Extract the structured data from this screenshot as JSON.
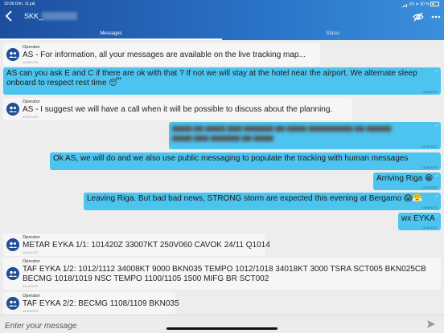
{
  "status_bar": {
    "time": "10:56",
    "date": "Dim. 11 juil.",
    "network": "3G",
    "battery": "50 %"
  },
  "header": {
    "title": "SKK_",
    "tabs": [
      {
        "label": "Messages",
        "active": true
      },
      {
        "label": "Status",
        "active": false
      }
    ]
  },
  "messages": [
    {
      "type": "operator",
      "sender": "Operator",
      "text": "AS - For information, all your messages are available on the live tracking map...",
      "time": "12:26 UTC"
    },
    {
      "type": "outgoing",
      "text": "AS can you ask E and C if there are ok with that ? If not we will stay at the hotel near the airport. We alternate sleep onboard to respect rest time 😴",
      "time": "12:28 UTC"
    },
    {
      "type": "operator",
      "sender": "Operator",
      "text": "AS - I suggest we will have a call when it will be possible to discuss about the planning.",
      "time": "12:37 UTC"
    },
    {
      "type": "outgoing",
      "blurred": true,
      "text": "",
      "time": "12:57 UTC"
    },
    {
      "type": "outgoing",
      "text": "Ok AS, we will do and we also use public messaging to populate the tracking with human messages",
      "time": "13:35 UTC"
    },
    {
      "type": "outgoing",
      "text": "Arriving Riga 😁",
      "time": "13:53 UTC"
    },
    {
      "type": "outgoing",
      "text": "Leaving Riga. But bad bad news, STRONG storm are expected this evening at Bergamo 😱😤",
      "time": "14:38 UTC"
    },
    {
      "type": "outgoing",
      "text": "wx EYKA",
      "time": "14:44 UTC"
    },
    {
      "type": "operator",
      "sender": "Operator",
      "text": "METAR EYKA 1/1: 101420Z 33007KT 250V060 CAVOK 24/11 Q1014",
      "time": "14:44 UTC"
    },
    {
      "type": "operator",
      "sender": "Operator",
      "text": "TAF EYKA 1/2: 1012/1112 34008KT 9000 BKN035  TEMPO 1012/1018 34018KT 3000 TSRA SCT005 BKN025CB BECMG 1018/1019 NSC  TEMPO 1100/1105 1500 MIFG BR SCT002",
      "time": "14:44 UTC"
    },
    {
      "type": "operator",
      "sender": "Operator",
      "text": "TAF EYKA 2/2: BECMG 1108/1109 BKN035",
      "time": "14:44 UTC"
    }
  ],
  "composer": {
    "placeholder": "Enter your message"
  },
  "icons": {
    "back": "back-chevron-icon",
    "tracking_off": "eye-slash-icon",
    "more": "more-dots-icon",
    "avatar": "group-avatar-icon",
    "send": "send-arrow-icon"
  },
  "colors": {
    "header_start": "#1d4e9e",
    "header_end": "#3b8fdb",
    "outgoing_bubble": "#4cc4ef",
    "operator_bubble": "#f6f6f6",
    "avatar": "#1f4f95"
  }
}
